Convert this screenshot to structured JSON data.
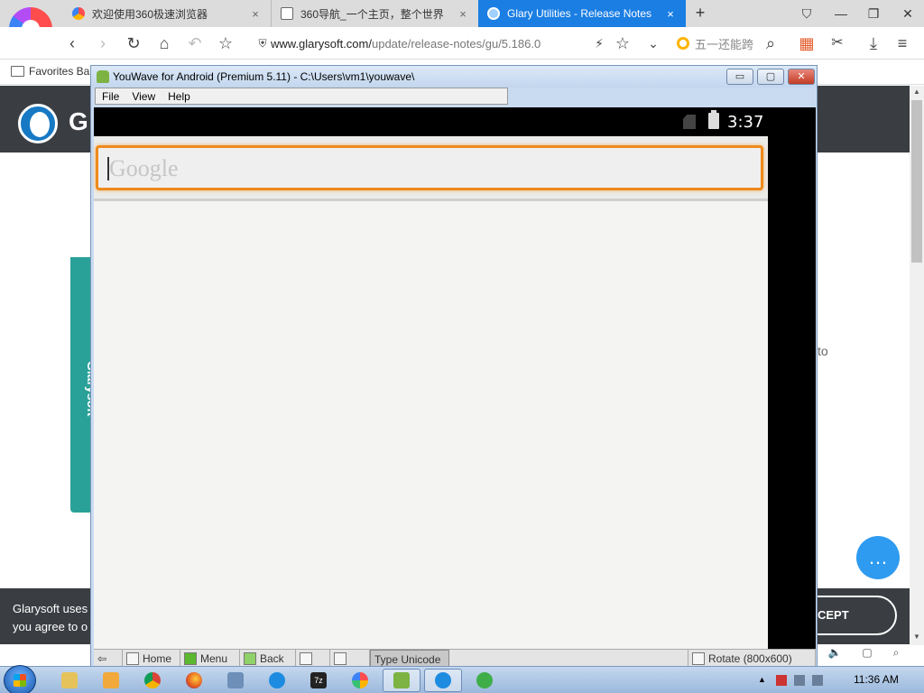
{
  "browser": {
    "tabs": [
      {
        "label": "欢迎使用360极速浏览器",
        "close": "×"
      },
      {
        "label": "360导航_一个主页，整个世界",
        "close": "×"
      },
      {
        "label": "Glary Utilities - Release Notes",
        "close": "×"
      }
    ],
    "new_tab": "+",
    "window_controls": {
      "pin": "⛉",
      "minimize": "—",
      "restore": "❐",
      "close": "✕"
    },
    "nav": {
      "back": "‹",
      "forward": "›",
      "reload": "↻",
      "home": "⌂",
      "undo": "↶",
      "star": "☆"
    },
    "address": {
      "host": "www.glarysoft.com/",
      "path": "update/release-notes/gu/5.186.0"
    },
    "address_actions": {
      "lightning": "⚡",
      "bookmark": "☆",
      "dropdown": "⌄"
    },
    "search_placeholder": "五一还能跨",
    "toolbar_icons": {
      "search": "⌕",
      "apps": "▦",
      "cut": "✂",
      "download": "⤓",
      "menu": "≡"
    },
    "favorites_bar_label": "Favorites Bar"
  },
  "website": {
    "logo_text": "G",
    "side_tab_label": "Glarysoft",
    "snippet": "to",
    "chat_icon": "…",
    "cookie_text": "Glarysoft uses\nyou agree to o",
    "accept_label": "CEPT"
  },
  "youwave": {
    "title": "YouWave for Android (Premium 5.11) - C:\\Users\\vm1\\youwave\\",
    "controls": {
      "minimize": "▭",
      "maximize": "▢",
      "close": "✕"
    },
    "menu": [
      "File",
      "View",
      "Help"
    ],
    "android": {
      "time": "3:37",
      "search_placeholder": "Google"
    },
    "toolbar": [
      "⇦",
      "Home",
      "Menu",
      "Back",
      "",
      "",
      "Type Unicode",
      "",
      "Rotate (800x600)"
    ]
  },
  "taskbar": {
    "time": "11:36 AM"
  },
  "colors": {
    "browser_active_tab": "#1a7ee3",
    "site_header": "#3a3d42",
    "side_tab": "#2aa198",
    "chat_bubble": "#2e9bf0",
    "google_box_border": "#ee8a1c"
  }
}
